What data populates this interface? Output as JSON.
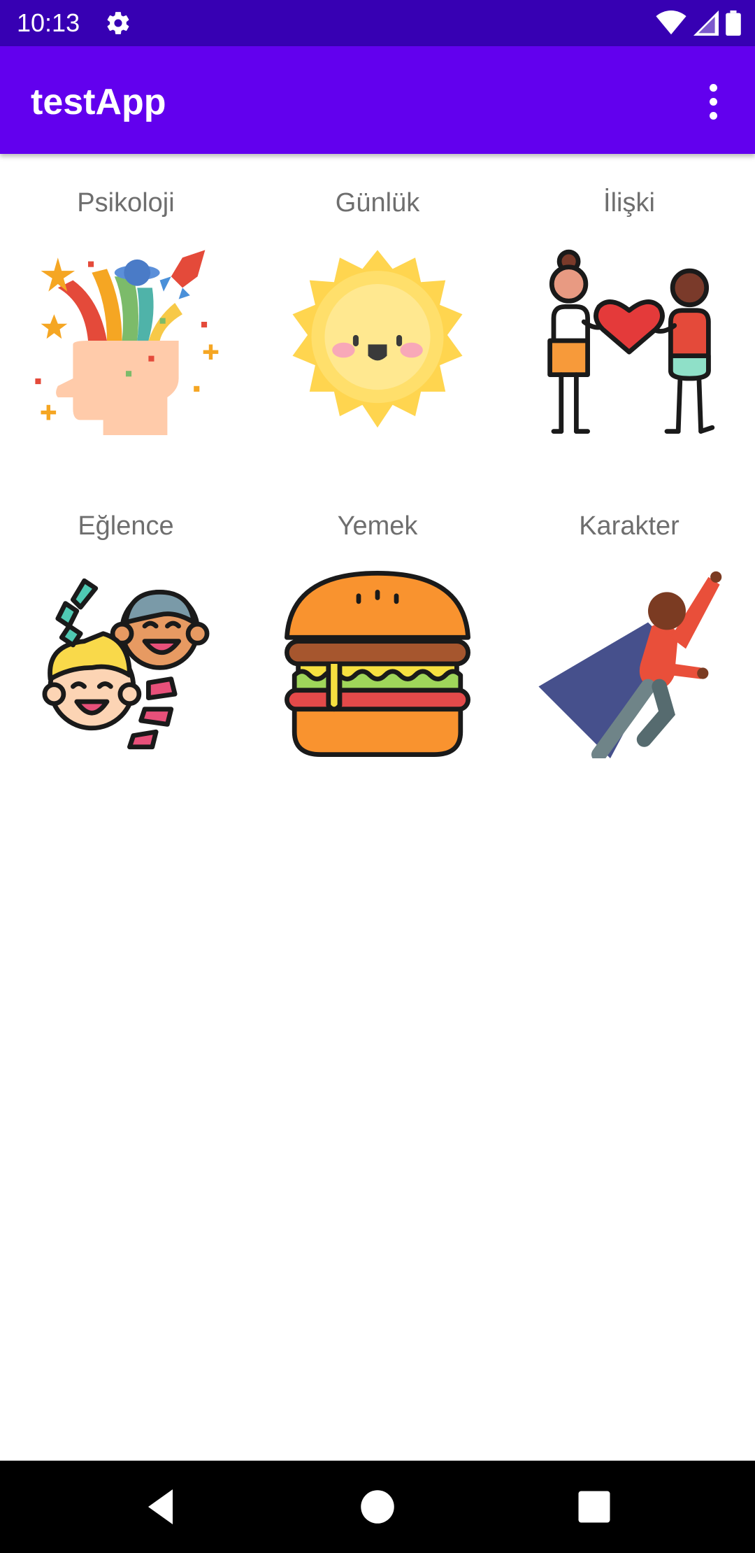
{
  "status_bar": {
    "time": "10:13",
    "icons": [
      "gear-icon",
      "wifi-icon",
      "signal-icon",
      "battery-icon"
    ]
  },
  "app_bar": {
    "title": "testApp",
    "menu_icon": "more-vert-icon"
  },
  "categories": [
    {
      "label": "Psikoloji",
      "icon": "mind-explosion-icon"
    },
    {
      "label": "Günlük",
      "icon": "smiling-sun-icon"
    },
    {
      "label": "İlişki",
      "icon": "couple-heart-icon"
    },
    {
      "label": "Eğlence",
      "icon": "laughing-friends-icon"
    },
    {
      "label": "Yemek",
      "icon": "hamburger-icon"
    },
    {
      "label": "Karakter",
      "icon": "superhero-icon"
    }
  ],
  "nav_bar": {
    "buttons": [
      "back-icon",
      "home-icon",
      "recents-icon"
    ]
  },
  "colors": {
    "status_bar": "#3700b3",
    "app_bar": "#6200ee",
    "label_text": "#6e6e6e"
  }
}
